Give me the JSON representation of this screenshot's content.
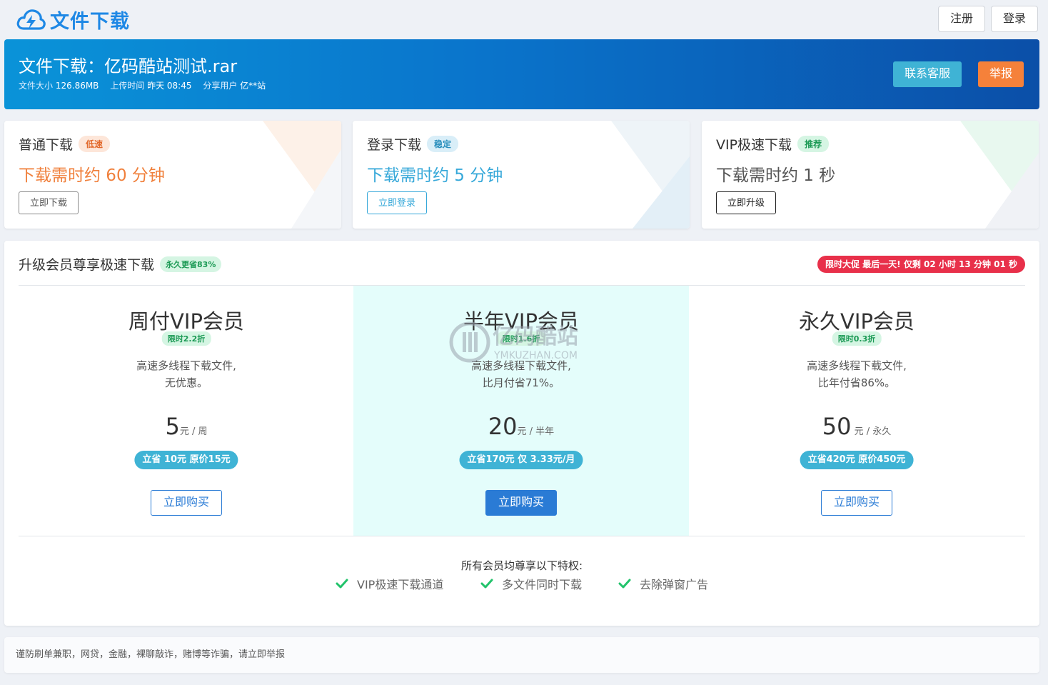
{
  "header": {
    "logo_text": "文件下载",
    "register_label": "注册",
    "login_label": "登录"
  },
  "file": {
    "title": "文件下载：亿码酷站测试.rar",
    "size_label": "文件大小",
    "size": "126.86MB",
    "upload_label": "上传时间",
    "upload_time": "昨天 08:45",
    "user_label": "分享用户",
    "user": "亿**站",
    "contact_label": "联系客服",
    "report_label": "举报"
  },
  "downloads": [
    {
      "title": "普通下载",
      "badge": "低速",
      "time": "下载需时约 60 分钟",
      "button": "立即下载"
    },
    {
      "title": "登录下载",
      "badge": "稳定",
      "time": "下载需时约 5 分钟",
      "button": "立即登录"
    },
    {
      "title": "VIP极速下载",
      "badge": "推荐",
      "time": "下载需时约 1 秒",
      "button": "立即升级"
    }
  ],
  "vip": {
    "heading": "升级会员尊享极速下载",
    "heading_badge": "永久更省83%",
    "promo": "限时大促 最后一天! 仅剩 02 小时 13 分钟 01 秒",
    "plans": [
      {
        "name": "周付VIP会员",
        "discount": "限时2.2折",
        "desc1": "高速多线程下载文件,",
        "desc2": "无优惠。",
        "price": "5",
        "unit": "元 / 周",
        "save": "立省 10元 原价15元",
        "button": "立即购买"
      },
      {
        "name": "半年VIP会员",
        "discount": "限时1.6折",
        "desc1": "高速多线程下载文件,",
        "desc2": "比月付省71%。",
        "price": "20",
        "unit": "元 / 半年",
        "save": "立省170元 仅 3.33元/月",
        "button": "立即购买"
      },
      {
        "name": "永久VIP会员",
        "discount": "限时0.3折",
        "desc1": "高速多线程下载文件,",
        "desc2": "比年付省86%。",
        "price": "50",
        "unit": " 元 / 永久",
        "save": "立省420元 原价450元",
        "button": "立即购买"
      }
    ],
    "privileges_title": "所有会员均尊享以下特权:",
    "privileges": [
      "VIP极速下载通道",
      "多文件同时下载",
      "去除弹窗广告"
    ]
  },
  "watermark": {
    "name": "亿码酷站",
    "domain": "YMKUZHAN.COM"
  },
  "footer": {
    "notice": "谨防刷单兼职，网贷，金融，裸聊敲诈，赌博等诈骗，请立即举报"
  },
  "colors": {
    "brand": "#1e88e5",
    "orange": "#f0803c",
    "cyan": "#36a8d9",
    "green": "#1c9a55",
    "red": "#e8304a",
    "buy_blue": "#2a7bd5"
  }
}
